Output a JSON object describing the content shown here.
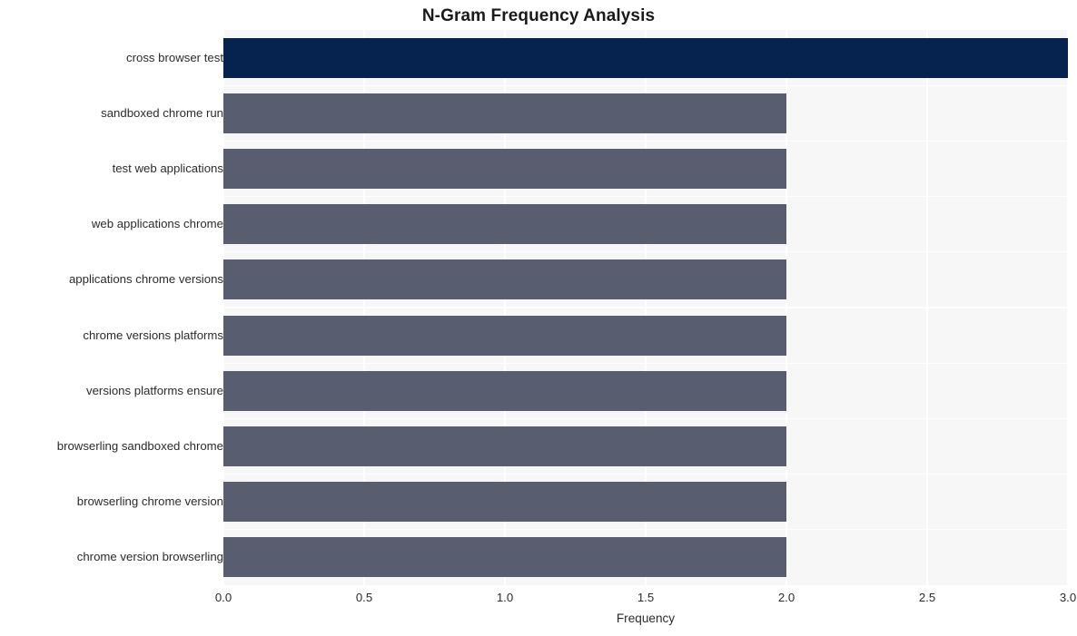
{
  "chart_data": {
    "type": "bar",
    "orientation": "horizontal",
    "title": "N-Gram Frequency Analysis",
    "xlabel": "Frequency",
    "ylabel": "",
    "xlim": [
      0,
      3
    ],
    "grid": true,
    "legend": "none",
    "xticks": [
      "0.0",
      "0.5",
      "1.0",
      "1.5",
      "2.0",
      "2.5",
      "3.0"
    ],
    "xtick_values": [
      0.0,
      0.5,
      1.0,
      1.5,
      2.0,
      2.5,
      3.0
    ],
    "categories": [
      "cross browser test",
      "sandboxed chrome run",
      "test web applications",
      "web applications chrome",
      "applications chrome versions",
      "chrome versions platforms",
      "versions platforms ensure",
      "browserling sandboxed chrome",
      "browserling chrome version",
      "chrome version browserling"
    ],
    "values": [
      3,
      2,
      2,
      2,
      2,
      2,
      2,
      2,
      2,
      2
    ],
    "bar_colors": [
      "#062350",
      "#585e70",
      "#585e70",
      "#585e70",
      "#585e70",
      "#585e70",
      "#585e70",
      "#585e70",
      "#585e70",
      "#585e70"
    ]
  },
  "style": {
    "plot_background": "#f7f7f8",
    "figure_background": "#ffffff",
    "gridline_color": "#ffffff",
    "tick_label_color": "#2b2b2b",
    "title_color": "#1a1a1a",
    "highlight_color": "#062350",
    "bar_color": "#585e70"
  }
}
